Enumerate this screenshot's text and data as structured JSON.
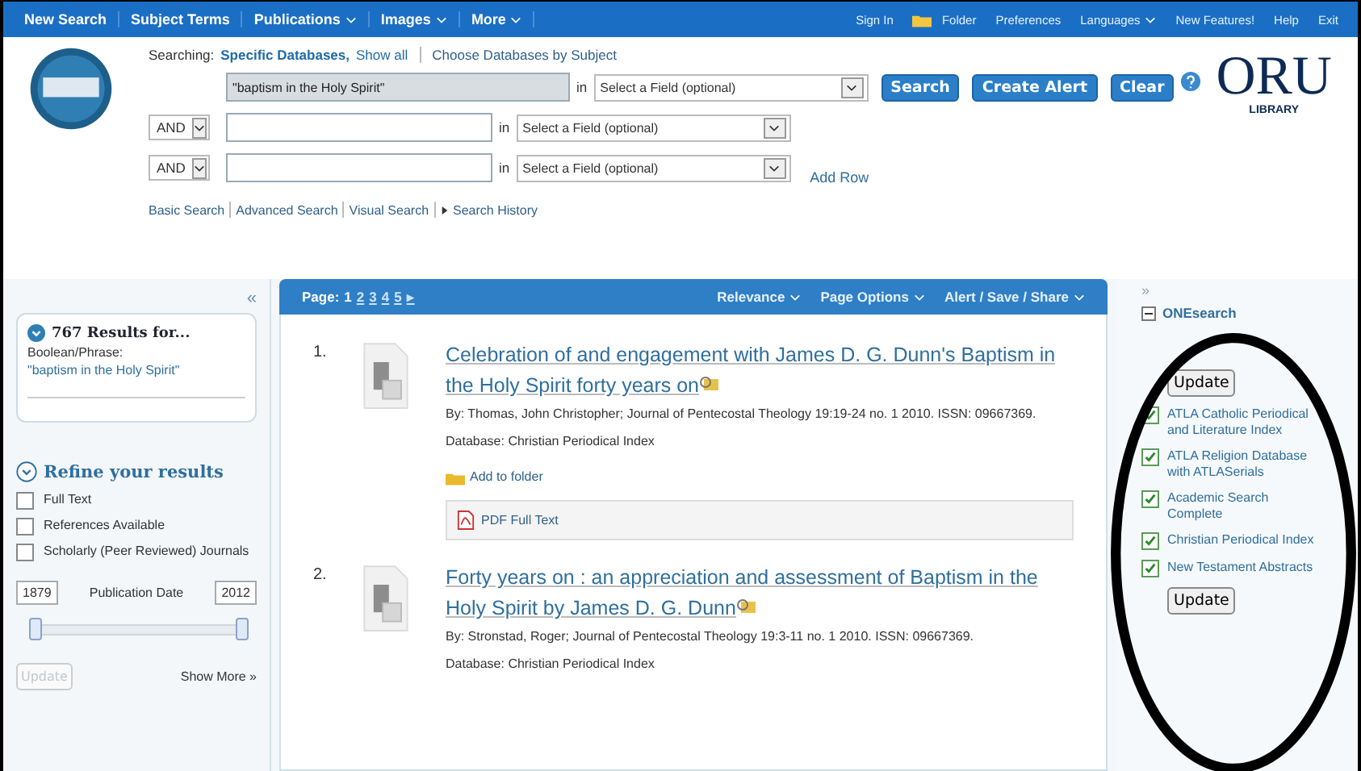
{
  "nav": {
    "left": [
      {
        "label": "New Search",
        "has_menu": false
      },
      {
        "label": "Subject Terms",
        "has_menu": false
      },
      {
        "label": "Publications",
        "has_menu": true
      },
      {
        "label": "Images",
        "has_menu": true
      },
      {
        "label": "More",
        "has_menu": true
      }
    ],
    "right": [
      {
        "label": "Sign In",
        "kind": "link",
        "has_menu": false
      },
      {
        "label": "Folder",
        "kind": "folder",
        "has_menu": false
      },
      {
        "label": "Preferences",
        "kind": "link",
        "has_menu": false
      },
      {
        "label": "Languages",
        "kind": "link",
        "has_menu": true
      },
      {
        "label": "New Features!",
        "kind": "link",
        "has_menu": false
      },
      {
        "label": "Help",
        "kind": "link",
        "has_menu": false
      },
      {
        "label": "Exit",
        "kind": "link",
        "has_menu": false
      }
    ]
  },
  "search": {
    "searching_label": "Searching:",
    "databases": "Specific Databases,",
    "show_all": "Show all",
    "choose": "Choose Databases by Subject",
    "rows": [
      {
        "operator": "",
        "value": "\"baptism in the Holy Spirit\"",
        "in": "in",
        "field": "Select a Field (optional)"
      },
      {
        "operator": "AND",
        "value": "",
        "in": "in",
        "field": "Select a Field (optional)"
      },
      {
        "operator": "AND",
        "value": "",
        "in": "in",
        "field": "Select a Field (optional)"
      }
    ],
    "buttons": [
      "Search",
      "Create Alert",
      "Clear"
    ],
    "add_row": "Add Row",
    "links": [
      "Basic Search",
      "Advanced Search",
      "Visual Search",
      "Search History"
    ]
  },
  "logo": {
    "name": "ORU",
    "sub": "LIBRARY"
  },
  "collapse": "«",
  "results_box": {
    "title": "767 Results for...",
    "type": "Boolean/Phrase:",
    "query": "\"baptism in the Holy Spirit\""
  },
  "refine": {
    "title": "Refine your results",
    "options": [
      {
        "label": "Full Text",
        "checked": false
      },
      {
        "label": "References Available",
        "checked": false
      },
      {
        "label": "Scholarly (Peer Reviewed) Journals",
        "checked": false
      }
    ],
    "date_from": "1879",
    "date_label": "Publication Date",
    "date_to": "2012",
    "date_range": {
      "level": 1
    },
    "update": {
      "label": "Update",
      "disabled": true
    },
    "show_more": "Show More »"
  },
  "toolbar": {
    "page_label": "Page:",
    "pages": [
      {
        "label": "1",
        "selected": true
      },
      {
        "label": "2",
        "selected": false
      },
      {
        "label": "3",
        "selected": false
      },
      {
        "label": "4",
        "selected": false
      },
      {
        "label": "5",
        "selected": false
      }
    ],
    "next": "▸",
    "menus": [
      "Relevance",
      "Page Options",
      "Alert / Save / Share"
    ]
  },
  "results": [
    {
      "number": "1.",
      "title": "Celebration of and engagement with James D. G. Dunn's Baptism in the Holy Spirit forty years on",
      "byline": "By: Thomas, John Christopher; Journal of Pentecostal Theology 19:19-24 no. 1 2010. ISSN: 09667369.",
      "database": "Database: Christian Periodical Index",
      "add_to_folder": "Add to folder",
      "full_text": "PDF Full Text"
    },
    {
      "number": "2.",
      "title": "Forty years on : an appreciation and assessment of Baptism in the Holy Spirit by James D. G. Dunn",
      "byline": "By: Stronstad, Roger; Journal of Pentecostal Theology 19:3-11 no. 1 2010. ISSN: 09667369.",
      "database": "Database: Christian Periodical Index"
    }
  ],
  "onesearch": {
    "expand": "»",
    "title": "ONEsearch",
    "update_top": "Update",
    "update_bottom": "Update",
    "databases": [
      {
        "label": "ATLA Catholic Periodical and Literature Index",
        "checked": true
      },
      {
        "label": "ATLA Religion Database with ATLASerials",
        "checked": true
      },
      {
        "label": "Academic Search Complete",
        "checked": true
      },
      {
        "label": "Christian Periodical Index",
        "checked": true
      },
      {
        "label": "New Testament Abstracts",
        "checked": true
      }
    ]
  }
}
